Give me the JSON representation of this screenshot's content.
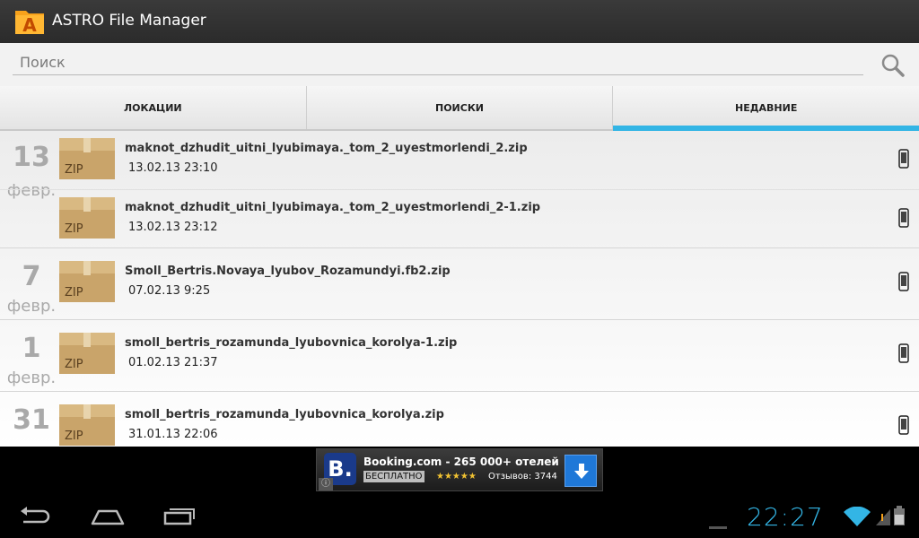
{
  "app": {
    "title": "ASTRO File Manager",
    "logo_letter": "A"
  },
  "search": {
    "placeholder": "Поиск"
  },
  "tabs": [
    {
      "label": "ЛОКАЦИИ"
    },
    {
      "label": "ПОИСКИ"
    },
    {
      "label": "НЕДАВНИЕ",
      "active": true
    }
  ],
  "groups": [
    {
      "day": "13",
      "month": "февр.",
      "files": [
        {
          "name": "maknot_dzhudit_uitni_lyubimaya._tom_2_uyestmorlendi_2.zip",
          "date": "13.02.13 23:10",
          "type": "ZIP"
        },
        {
          "name": "maknot_dzhudit_uitni_lyubimaya._tom_2_uyestmorlendi_2-1.zip",
          "date": "13.02.13 23:12",
          "type": "ZIP"
        }
      ]
    },
    {
      "day": "7",
      "month": "февр.",
      "files": [
        {
          "name": "Smoll_Bertris.Novaya_lyubov_Rozamundyi.fb2.zip",
          "date": "07.02.13 9:25",
          "type": "ZIP"
        }
      ]
    },
    {
      "day": "1",
      "month": "февр.",
      "files": [
        {
          "name": "smoll_bertris_rozamunda_lyubovnica_korolya-1.zip",
          "date": "01.02.13 21:37",
          "type": "ZIP"
        }
      ]
    },
    {
      "day": "31",
      "month": "",
      "files": [
        {
          "name": "smoll_bertris_rozamunda_lyubovnica_korolya.zip",
          "date": "31.01.13 22:06",
          "type": "ZIP"
        }
      ]
    }
  ],
  "ad": {
    "logo": "B.",
    "title": "Booking.com - 265 000+ отелей",
    "free": "БЕСПЛАТНО",
    "stars": "★★★★★",
    "reviews": "Отзывов: 3744",
    "info": "ⓘ"
  },
  "status": {
    "clock": "22:27"
  },
  "colors": {
    "accent": "#33b5e5",
    "zip": "#c9a46a"
  }
}
